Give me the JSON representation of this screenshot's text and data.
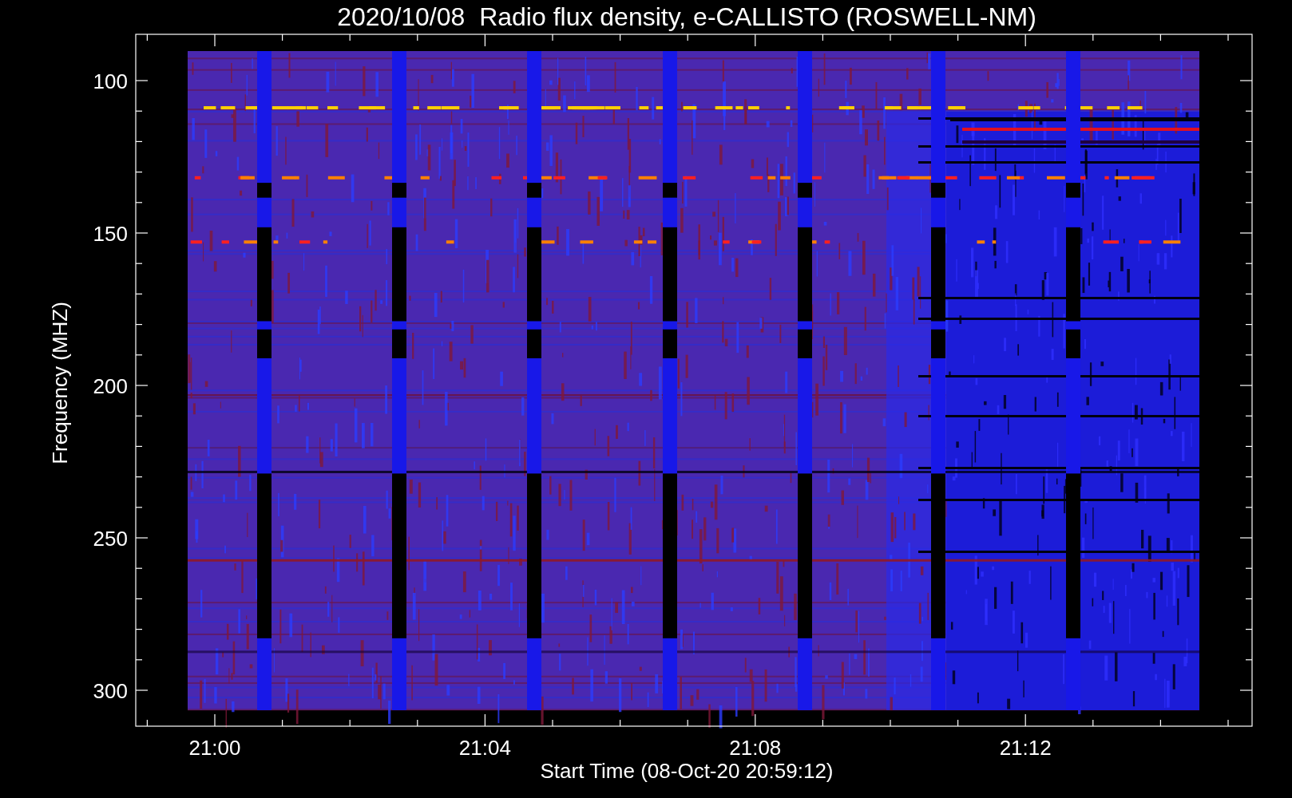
{
  "title": "2020/10/08  Radio flux density, e-CALLISTO (ROSWELL-NM)",
  "ylabel": "Frequency (MHZ)",
  "xlabel": "Start Time (08-Oct-20 20:59:12)",
  "yticks": [
    "100",
    "150",
    "200",
    "250",
    "300"
  ],
  "xticks": [
    "21:00",
    "21:04",
    "21:08",
    "21:12"
  ]
}
